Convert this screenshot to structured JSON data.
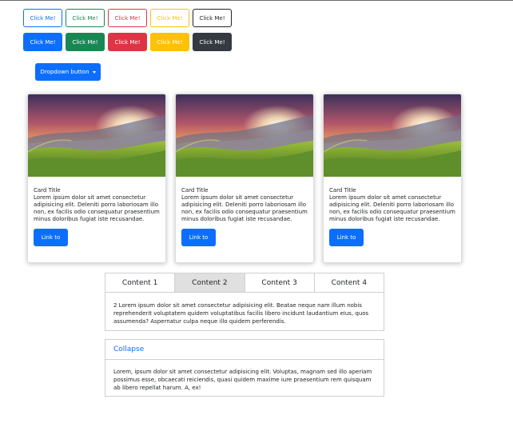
{
  "outline_buttons": [
    {
      "label": "Click Me!",
      "color": "#0d6efd"
    },
    {
      "label": "Click Me!",
      "color": "#198754"
    },
    {
      "label": "Click Me!",
      "color": "#dc3545"
    },
    {
      "label": "Click Me!",
      "color": "#ffc107"
    },
    {
      "label": "Click Me!",
      "color": "#212529"
    }
  ],
  "solid_buttons": [
    {
      "label": "Click Me!",
      "bg": "#0d6efd",
      "fg": "#ffffff"
    },
    {
      "label": "Click Me!",
      "bg": "#198754",
      "fg": "#ffffff"
    },
    {
      "label": "Click Me!",
      "bg": "#dc3545",
      "fg": "#ffffff"
    },
    {
      "label": "Click Me!",
      "bg": "#ffc107",
      "fg": "#ffffff"
    },
    {
      "label": "Click Me!",
      "bg": "#343a40",
      "fg": "#ffffff"
    }
  ],
  "dropdown": {
    "label": "Dropdown button",
    "icon": "caret-down-icon"
  },
  "cards": [
    {
      "image": "mountain-sunset-landscape",
      "title": "Card Title",
      "text": "Lorem ipsum dolor sit amet consectetur adipisicing elit. Deleniti porro laboriosam illo non, ex facilis odio consequatur praesentium minus doloribus fugiat iste recusandae.",
      "link": "Link to"
    },
    {
      "image": "mountain-sunset-landscape",
      "title": "Card Title",
      "text": "Lorem ipsum dolor sit amet consectetur adipisicing elit. Deleniti porro laboriosam illo non, ex facilis odio consequatur praesentium minus doloribus fugiat iste recusandae.",
      "link": "Link to"
    },
    {
      "image": "mountain-sunset-landscape",
      "title": "Card Title",
      "text": "Lorem ipsum dolor sit amet consectetur adipisicing elit. Deleniti porro laboriosam illo non, ex facilis odio consequatur praesentium minus doloribus fugiat iste recusandae.",
      "link": "Link to"
    }
  ],
  "tabs": {
    "items": [
      "Content 1",
      "Content 2",
      "Content 3",
      "Content 4"
    ],
    "active_index": 1,
    "content": "2 Lorem ipsum dolor sit amet consectetur adipisicing elit. Beatae neque nam illum nobis reprehenderit voluptatem quidem voluptatibus facilis libero incidunt laudantium eius, quos assumenda? Aspernatur culpa neque illo quidem perferendis."
  },
  "collapse": {
    "header": "Collapse",
    "body": "Lorem, ipsum dolor sit amet consectetur adipisicing elit. Voluptas, magnam sed illo aperiam possimus esse, obcaecati reiciendis, quasi quidem maxime iure praesentium rem quisquam ab libero repellat harum. A, ex!"
  }
}
